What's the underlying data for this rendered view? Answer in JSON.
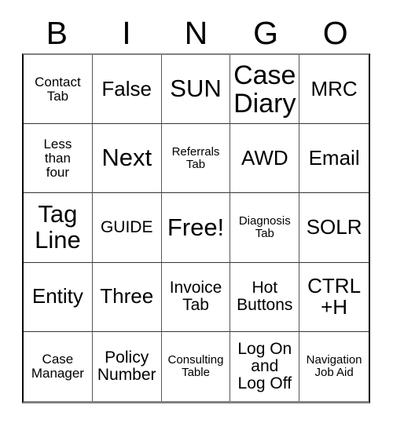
{
  "card": {
    "title_letters": [
      "B",
      "I",
      "N",
      "G",
      "O"
    ],
    "columns": 5,
    "rows": 5,
    "free_space_label": "Free!",
    "free_space_position": "center",
    "cells": [
      {
        "text": "Contact\nTab",
        "size": "sm"
      },
      {
        "text": "False",
        "size": "lg"
      },
      {
        "text": "SUN",
        "size": "xl"
      },
      {
        "text": "Case\nDiary",
        "size": "xxl"
      },
      {
        "text": "MRC",
        "size": "lg"
      },
      {
        "text": "Less\nthan\nfour",
        "size": "sm"
      },
      {
        "text": "Next",
        "size": "xl"
      },
      {
        "text": "Referrals\nTab",
        "size": "xs"
      },
      {
        "text": "AWD",
        "size": "lg"
      },
      {
        "text": "Email",
        "size": "lg"
      },
      {
        "text": "Tag\nLine",
        "size": "xl"
      },
      {
        "text": "GUIDE",
        "size": "md"
      },
      {
        "text": "Free!",
        "size": "xl"
      },
      {
        "text": "Diagnosis\nTab",
        "size": "xs"
      },
      {
        "text": "SOLR",
        "size": "lg"
      },
      {
        "text": "Entity",
        "size": "lg"
      },
      {
        "text": "Three",
        "size": "lg"
      },
      {
        "text": "Invoice\nTab",
        "size": "md"
      },
      {
        "text": "Hot\nButtons",
        "size": "md"
      },
      {
        "text": "CTRL\n+H",
        "size": "lg"
      },
      {
        "text": "Case\nManager",
        "size": "sm"
      },
      {
        "text": "Policy\nNumber",
        "size": "md"
      },
      {
        "text": "Consulting\nTable",
        "size": "xs"
      },
      {
        "text": "Log On\nand\nLog Off",
        "size": "md"
      },
      {
        "text": "Navigation\nJob Aid",
        "size": "xs"
      }
    ]
  },
  "colors": {
    "background": "#ffffff",
    "text": "#000000",
    "grid_line": "#333333",
    "grid_outer": "#808080"
  }
}
